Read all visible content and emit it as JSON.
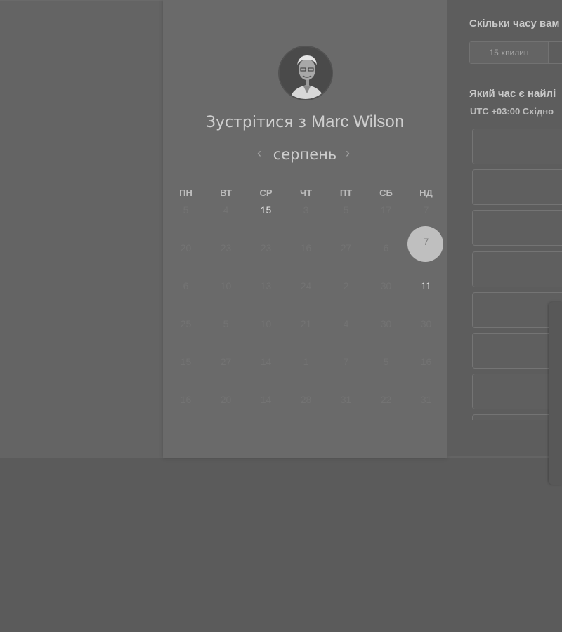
{
  "header": {
    "title_prefix": "Зустрітися з",
    "host_name": "Marc Wilson"
  },
  "calendar": {
    "prev_label": "‹",
    "next_label": "›",
    "month": "серпень",
    "weekdays": [
      "ПН",
      "ВТ",
      "СР",
      "ЧТ",
      "ПТ",
      "СБ",
      "НД"
    ],
    "weeks": [
      [
        "5",
        "4",
        "15",
        "3",
        "5",
        "17",
        "7"
      ],
      [
        "20",
        "23",
        "23",
        "16",
        "27",
        "6",
        "7"
      ],
      [
        "6",
        "10",
        "13",
        "24",
        "2",
        "30",
        "11"
      ],
      [
        "25",
        "5",
        "10",
        "21",
        "4",
        "30",
        "30"
      ],
      [
        "15",
        "27",
        "14",
        "1",
        "7",
        "5",
        "16"
      ],
      [
        "16",
        "20",
        "14",
        "28",
        "31",
        "22",
        "31"
      ]
    ],
    "selected_day": "7",
    "active_days": [
      "15",
      "11"
    ]
  },
  "right_panel": {
    "question_duration": "Скільки часу вам",
    "duration_option": "15 хвилин",
    "question_time": "Який час є найлі",
    "timezone": "UTC +03:00 Східно"
  },
  "colors": {
    "overlay_dim": "#646464",
    "selected_circle": "#bfbfbf"
  }
}
